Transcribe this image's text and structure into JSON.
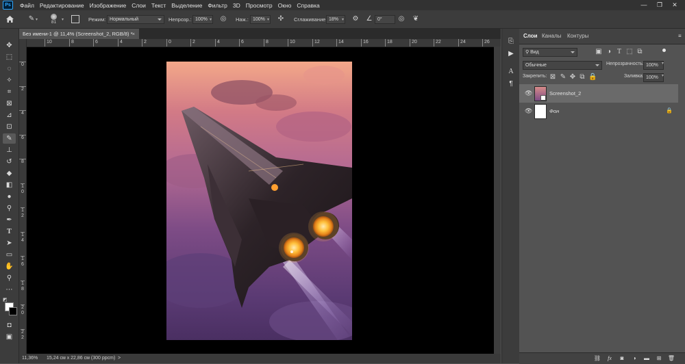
{
  "app": {
    "logo": "Ps",
    "menu": [
      "Файл",
      "Редактирование",
      "Изображение",
      "Слои",
      "Текст",
      "Выделение",
      "Фильтр",
      "3D",
      "Просмотр",
      "Окно",
      "Справка"
    ],
    "window_controls": {
      "minimize": "—",
      "maximize": "❐",
      "close": "✕"
    }
  },
  "options_bar": {
    "brush_size": "81",
    "mode_label": "Режим:",
    "mode_value": "Нормальный",
    "opacity_label": "Непрозр.:",
    "opacity_value": "100%",
    "flow_label": "Наж.:",
    "flow_value": "100%",
    "smoothing_label": "Сглаживание:",
    "smoothing_value": "18%",
    "angle_value": "0°"
  },
  "document": {
    "tab_title": "Без имени-1 @ 11,4% (Screenshot_2, RGB/8) *",
    "tab_close": "×",
    "ruler_h": [
      "10",
      "8",
      "6",
      "4",
      "2",
      "0",
      "2",
      "4",
      "6",
      "8",
      "10",
      "12",
      "14",
      "16",
      "18",
      "20",
      "22",
      "24",
      "26"
    ],
    "ruler_v": [
      "0",
      "2",
      "4",
      "6",
      "8",
      "1 0",
      "1 2",
      "1 4",
      "1 6",
      "1 8",
      "2 0",
      "2 2"
    ]
  },
  "status_bar": {
    "zoom": "11,36%",
    "doc_size": "15,24 см x 22,86 см (300 ppcm)",
    "arrow": ">"
  },
  "layers_panel": {
    "tabs": [
      "Слои",
      "Каналы",
      "Контуры"
    ],
    "filter_label": "Вид",
    "blend_mode": "Обычные",
    "opacity_label": "Непрозрачность:",
    "opacity_value": "100%",
    "lock_label": "Закрепить:",
    "fill_label": "Заливка:",
    "fill_value": "100%",
    "layers": [
      {
        "name": "Screenshot_2",
        "visible": true,
        "selected": true,
        "locked": false
      },
      {
        "name": "Фон",
        "visible": true,
        "selected": false,
        "locked": true
      }
    ]
  },
  "colors": {
    "menubar_bg": "#323232",
    "panel_bg": "#535353",
    "canvas_bg": "#000000",
    "selected_layer": "#6a6a6a"
  }
}
